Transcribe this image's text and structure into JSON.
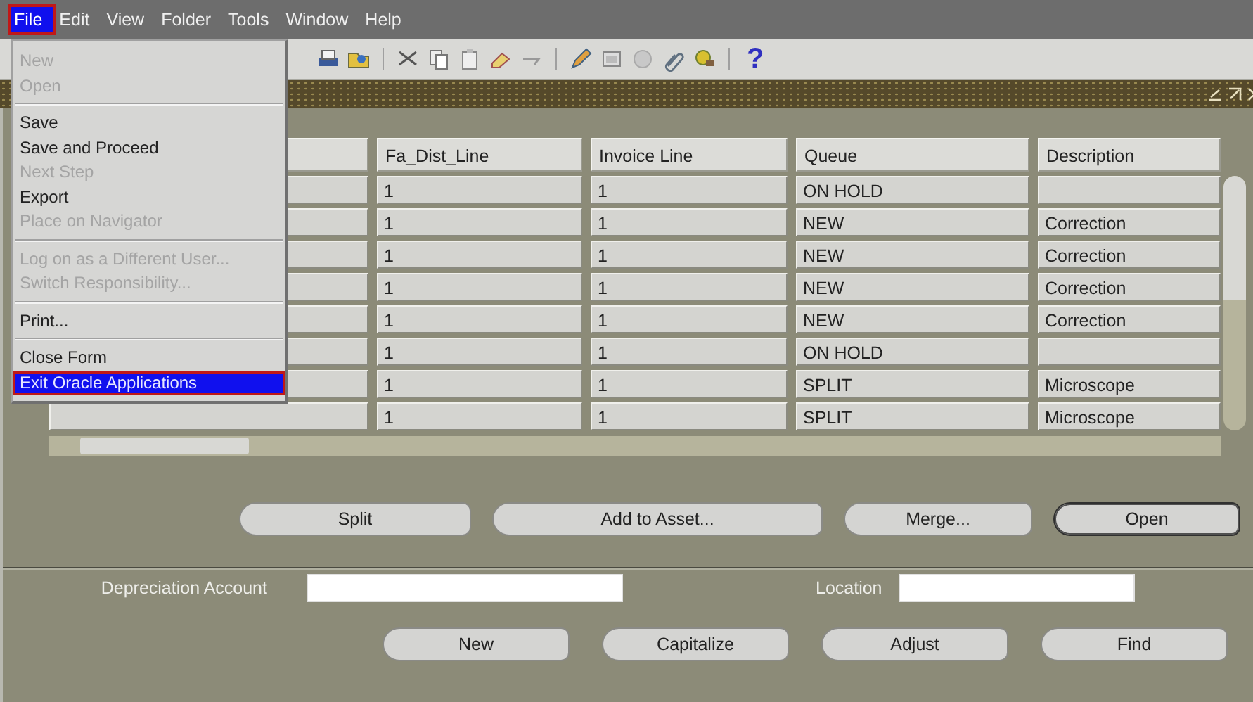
{
  "menubar": [
    {
      "label": "File",
      "selected": true,
      "highlighted": true
    },
    {
      "label": "Edit",
      "selected": false,
      "highlighted": false
    },
    {
      "label": "View",
      "selected": false,
      "highlighted": false
    },
    {
      "label": "Folder",
      "selected": false,
      "highlighted": false
    },
    {
      "label": "Tools",
      "selected": false,
      "highlighted": false
    },
    {
      "label": "Window",
      "selected": false,
      "highlighted": false
    },
    {
      "label": "Help",
      "selected": false,
      "highlighted": false
    }
  ],
  "toolbar": {
    "help_glyph": "?"
  },
  "file_menu": [
    {
      "kind": "item",
      "label": "New",
      "disabled": true,
      "selected": false,
      "highlighted": false
    },
    {
      "kind": "item",
      "label": "Open",
      "disabled": true,
      "selected": false,
      "highlighted": false
    },
    {
      "kind": "separator"
    },
    {
      "kind": "item",
      "label": "Save",
      "disabled": false,
      "selected": false,
      "highlighted": false
    },
    {
      "kind": "item",
      "label": "Save and Proceed",
      "disabled": false,
      "selected": false,
      "highlighted": false
    },
    {
      "kind": "item",
      "label": "Next Step",
      "disabled": true,
      "selected": false,
      "highlighted": false
    },
    {
      "kind": "item",
      "label": "Export",
      "disabled": false,
      "selected": false,
      "highlighted": false
    },
    {
      "kind": "item",
      "label": "Place on Navigator",
      "disabled": true,
      "selected": false,
      "highlighted": false
    },
    {
      "kind": "separator"
    },
    {
      "kind": "item",
      "label": "Log on as a Different User...",
      "disabled": true,
      "selected": false,
      "highlighted": false
    },
    {
      "kind": "item",
      "label": "Switch Responsibility...",
      "disabled": true,
      "selected": false,
      "highlighted": false
    },
    {
      "kind": "separator"
    },
    {
      "kind": "item",
      "label": "Print...",
      "disabled": false,
      "selected": false,
      "highlighted": false
    },
    {
      "kind": "separator"
    },
    {
      "kind": "item",
      "label": "Close Form",
      "disabled": false,
      "selected": false,
      "highlighted": false
    },
    {
      "kind": "item",
      "label": "Exit Oracle Applications",
      "disabled": false,
      "selected": true,
      "highlighted": true
    }
  ],
  "table": {
    "columns": [
      "Fa_Dist_Line",
      "Invoice Line",
      "Queue",
      "Description"
    ],
    "rows": [
      [
        "1",
        "1",
        "ON HOLD"
      ],
      [
        "1",
        "1",
        "NEW",
        "Correction"
      ],
      [
        "1",
        "1",
        "NEW",
        "Correction"
      ],
      [
        "1",
        "1",
        "NEW",
        "Correction"
      ],
      [
        "1",
        "1",
        "NEW",
        "Correction"
      ],
      [
        "1",
        "1",
        "ON HOLD"
      ],
      [
        "1",
        "1",
        "SPLIT",
        "Microscope"
      ],
      [
        "1",
        "1",
        "SPLIT",
        "Microscope"
      ]
    ]
  },
  "actions": [
    {
      "label": "Split",
      "default": false
    },
    {
      "label": "Add to Asset...",
      "default": false
    },
    {
      "label": "Merge...",
      "default": false
    },
    {
      "label": "Open",
      "default": true
    }
  ],
  "form_fields": [
    {
      "label": "Depreciation Account"
    },
    {
      "label": "Location"
    }
  ],
  "bottom_actions": [
    {
      "label": "New",
      "default": false
    },
    {
      "label": "Capitalize",
      "default": false
    },
    {
      "label": "Adjust",
      "default": false
    },
    {
      "label": "Find",
      "default": false
    }
  ]
}
